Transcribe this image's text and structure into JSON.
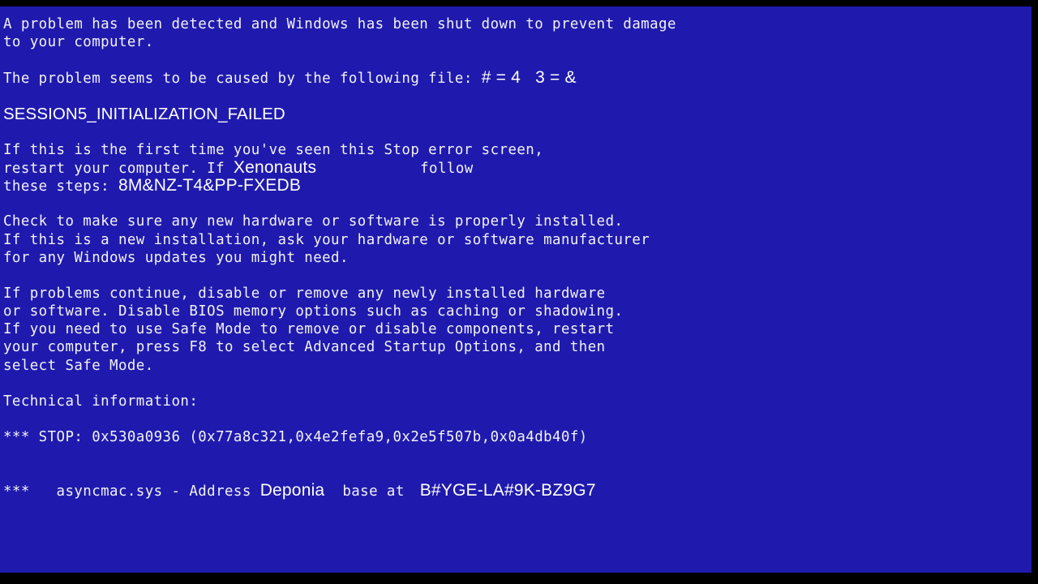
{
  "screen": {
    "background_color": "#1f1aad",
    "text_color": "#f2f2f8",
    "letterbox_color": "#000000"
  },
  "bsod": {
    "intro": {
      "line1": "A problem has been detected and Windows has been shut down to prevent damage",
      "line2": "to your computer."
    },
    "cause": {
      "prefix": "The problem seems to be caused by the following file: ",
      "injected_file": "# = 4   3 = &"
    },
    "error_code": "SESSION5_INITIALIZATION_FAILED",
    "first_time": {
      "line1": "If this is the first time you've seen this Stop error screen,",
      "line2_prefix": "restart your computer. If ",
      "line2_injected": "Xenonauts",
      "line2_suffix": "follow",
      "line3_prefix": "these steps: ",
      "line3_injected": "8M&NZ-T4&PP-FXEDB"
    },
    "hardware_advice": {
      "line1": "Check to make sure any new hardware or software is properly installed.",
      "line2": "If this is a new installation, ask your hardware or software manufacturer",
      "line3": "for any Windows updates you might need."
    },
    "troubleshooting": {
      "line1": "If problems continue, disable or remove any newly installed hardware",
      "line2": "or software. Disable BIOS memory options such as caching or shadowing.",
      "line3": "If you need to use Safe Mode to remove or disable components, restart",
      "line4": "your computer, press F8 to select Advanced Startup Options, and then",
      "line5": "select Safe Mode."
    },
    "technical": {
      "heading": "Technical information:",
      "stop_line": "*** STOP: 0x530a0936 (0x77a8c321,0x4e2fefa9,0x2e5f507b,0x0a4db40f)",
      "driver_prefix": "***   asyncmac.sys - Address ",
      "driver_injected_address": "Deponia",
      "driver_middle": "base at ",
      "driver_injected_base": "B#YGE-LA#9K-BZ9G7"
    }
  }
}
